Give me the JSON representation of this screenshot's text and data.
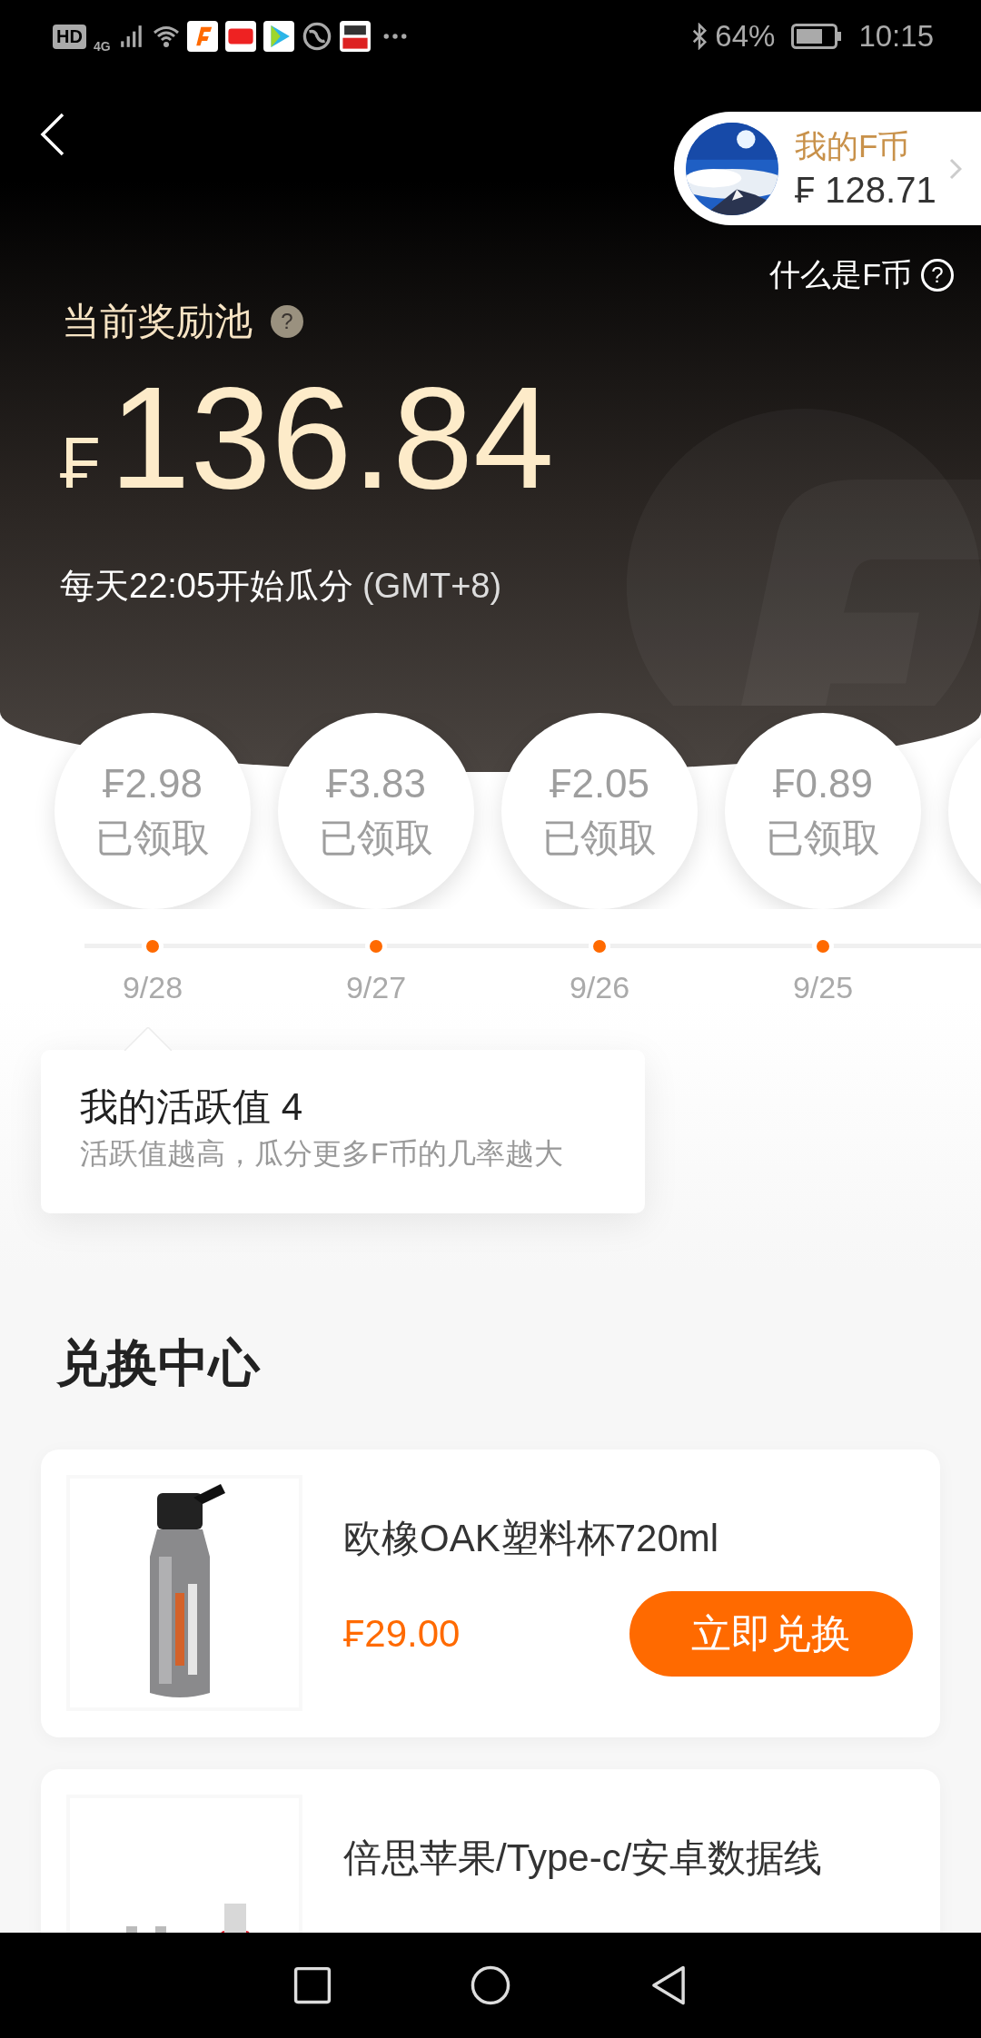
{
  "status_bar": {
    "hd": "HD",
    "network": "4G",
    "battery": "64%",
    "time": "10:15"
  },
  "wallet": {
    "label": "我的F币",
    "amount": "₣ 128.71"
  },
  "help_link": {
    "label": "什么是F币",
    "mark": "?"
  },
  "pool": {
    "title": "当前奖励池",
    "mark": "?",
    "currency": "₣",
    "amount": "136.84",
    "schedule": "每天22:05开始瓜分",
    "timezone": "(GMT+8)"
  },
  "rewards": [
    {
      "amount": "₣2.98",
      "status": "已领取",
      "date": "9/28",
      "claimed": true
    },
    {
      "amount": "₣3.83",
      "status": "已领取",
      "date": "9/27",
      "claimed": true
    },
    {
      "amount": "₣2.05",
      "status": "已领取",
      "date": "9/26",
      "claimed": true
    },
    {
      "amount": "₣0.89",
      "status": "已领取",
      "date": "9/25",
      "claimed": true
    }
  ],
  "activity": {
    "title": "我的活跃值 4",
    "hint": "活跃值越高，瓜分更多F币的几率越大"
  },
  "exchange": {
    "title": "兑换中心",
    "products": [
      {
        "name": "欧橡OAK塑料杯720ml",
        "price": "₣29.00",
        "button": "立即兑换",
        "kind": "picture"
      },
      {
        "name": "倍思苹果/Type-c/安卓数据线",
        "kind": "picture"
      }
    ]
  }
}
